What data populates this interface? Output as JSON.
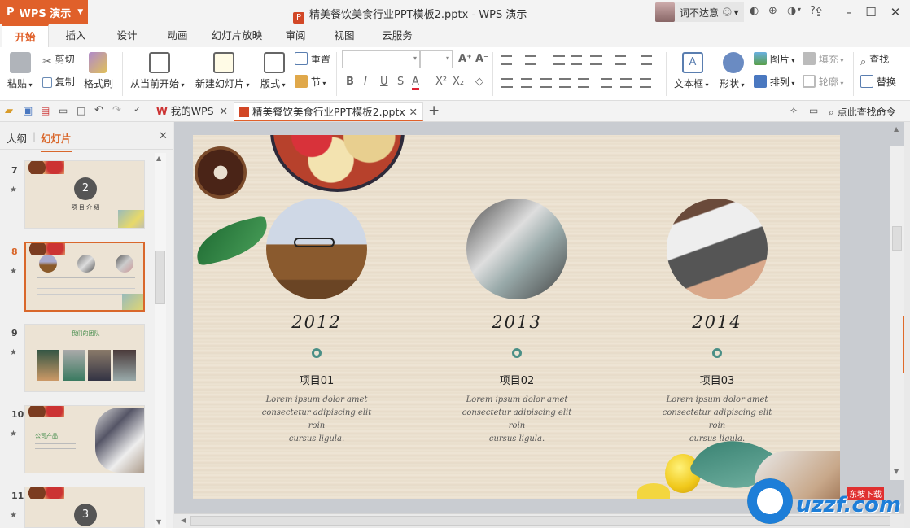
{
  "titlebar": {
    "app_name": "WPS 演示",
    "document_title": "精美餐饮美食行业PPT模板2.pptx - WPS 演示",
    "user_name": "词不达意"
  },
  "ribbon_tabs": [
    "开始",
    "插入",
    "设计",
    "动画",
    "幻灯片放映",
    "审阅",
    "视图",
    "云服务"
  ],
  "ribbon": {
    "paste": "粘贴",
    "cut": "剪切",
    "copy": "复制",
    "format_painter": "格式刷",
    "from_current": "从当前开始",
    "new_slide": "新建幻灯片",
    "layout": "版式",
    "reset": "重置",
    "section": "节",
    "textbox": "文本框",
    "shape": "形状",
    "picture": "图片",
    "arrange": "排列",
    "fill": "填充",
    "outline": "轮廓",
    "find": "查找",
    "replace": "替换"
  },
  "quickbar": {
    "tab_mywps": "我的WPS",
    "tab_doc": "精美餐饮美食行业PPT模板2.pptx",
    "search_cmd": "点此查找命令"
  },
  "leftpanel": {
    "tab_outline": "大纲",
    "tab_slides": "幻灯片",
    "slides": [
      {
        "num": "7",
        "badge": "2",
        "caption": "项 目 介 绍"
      },
      {
        "num": "8"
      },
      {
        "num": "9",
        "caption": "我们的团队"
      },
      {
        "num": "10",
        "caption": "公司产品"
      },
      {
        "num": "11",
        "badge": "3"
      }
    ]
  },
  "slide": {
    "items": [
      {
        "year": "2012",
        "title": "项目01",
        "body": [
          "Lorem ipsum dolor amet",
          "consectetur adipiscing elit",
          "roin",
          "cursus ligula."
        ]
      },
      {
        "year": "2013",
        "title": "项目02",
        "body": [
          "Lorem ipsum dolor amet",
          "consectetur adipiscing elit",
          "roin",
          "cursus ligula."
        ]
      },
      {
        "year": "2014",
        "title": "项目03",
        "body": [
          "Lorem ipsum dolor amet",
          "consectetur adipiscing elit",
          "roin",
          "cursus ligula."
        ]
      }
    ]
  },
  "watermark": {
    "text": "uzzf.com",
    "sub": "东坡下载"
  }
}
